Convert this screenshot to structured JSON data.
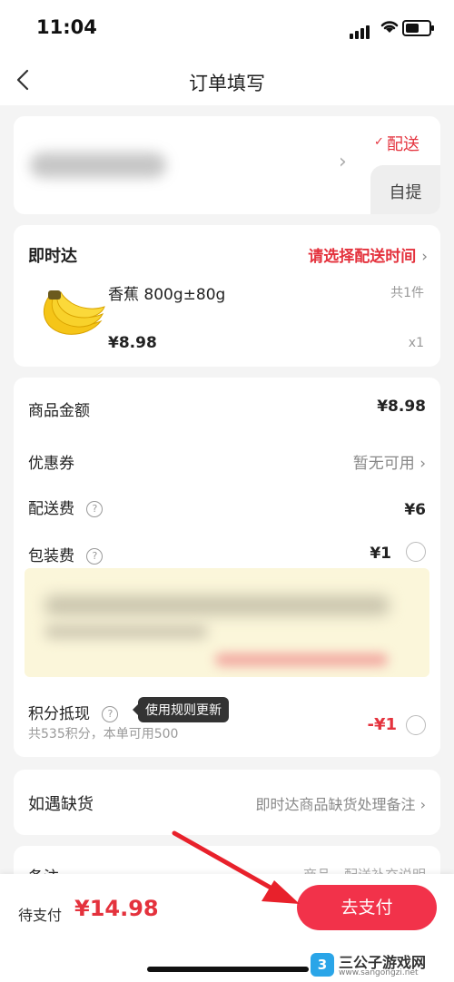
{
  "status_bar": {
    "time": "11:04"
  },
  "nav": {
    "title": "订单填写"
  },
  "delivery_options": {
    "delivery": "配送",
    "pickup": "自提"
  },
  "instant": {
    "title": "即时达",
    "time_select": "请选择配送时间",
    "product_name": "香蕉 800g±80g",
    "count": "共1件",
    "price": "¥8.98",
    "quantity": "x1"
  },
  "fees": {
    "goods_label": "商品金额",
    "goods_value": "¥8.98",
    "coupon_label": "优惠券",
    "coupon_value": "暂无可用",
    "delivery_label": "配送费",
    "delivery_value": "¥6",
    "packing_label": "包装费",
    "packing_value": "¥1",
    "points_label": "积分抵现",
    "points_tooltip": "使用规则更新",
    "points_sub": "共535积分，本单可用500",
    "points_value": "-¥1"
  },
  "stockout": {
    "label": "如遇缺货",
    "value": "即时达商品缺货处理备注"
  },
  "remark": {
    "label": "备注",
    "value": "商品、配送补充说明"
  },
  "bottom": {
    "pay_label": "待支付",
    "pay_amount": "¥14.98",
    "pay_button": "去支付"
  },
  "watermark": {
    "title": "三公子游戏网",
    "url": "www.sangongzi.net"
  },
  "colors": {
    "accent": "#e4323d",
    "button": "#f2324a"
  }
}
